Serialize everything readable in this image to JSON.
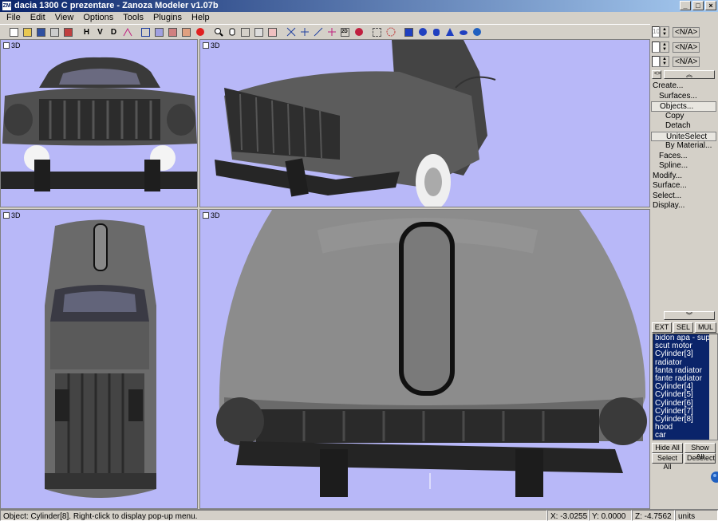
{
  "window": {
    "title": "dacia 1300 C prezentare - Zanoza Modeler v1.07b",
    "app_icon": "ZM"
  },
  "menu": [
    "File",
    "Edit",
    "View",
    "Options",
    "Tools",
    "Plugins",
    "Help"
  ],
  "toolbar": {
    "h_label": "H",
    "v_label": "V",
    "d_label": "D"
  },
  "viewports": {
    "top_left": {
      "label": "3D"
    },
    "top_right": {
      "label": "3D"
    },
    "bottom_left": {
      "label": "3D"
    },
    "bottom_right": {
      "label": "3D"
    },
    "background_color": "#b8b8f8"
  },
  "panel": {
    "spinners": [
      "<N/A>",
      "<N/A>",
      "<N/A>"
    ],
    "spinner_first_value": "10",
    "commands": [
      {
        "label": "Create...",
        "level": 1
      },
      {
        "label": "Surfaces...",
        "level": 2
      },
      {
        "label": "Objects...",
        "level": 2,
        "boxed": true
      },
      {
        "label": "Copy",
        "level": 3
      },
      {
        "label": "Detach",
        "level": 3
      },
      {
        "label": "UniteSelect",
        "level": 3,
        "boxed": true
      },
      {
        "label": "By Material...",
        "level": 3
      },
      {
        "label": "Faces...",
        "level": 2
      },
      {
        "label": "Spline...",
        "level": 2
      },
      {
        "label": "Modify...",
        "level": 1
      },
      {
        "label": "Surface...",
        "level": 1
      },
      {
        "label": "Select...",
        "level": 1
      },
      {
        "label": "Display...",
        "level": 1
      }
    ],
    "mode_buttons": [
      "EXT",
      "SEL",
      "MUL"
    ],
    "objects": [
      "bidon apa - supor",
      "scut motor",
      "Cylinder[3]",
      "radiator",
      "fanta radiator",
      "fante radiator",
      "Cylinder[4]",
      "Cylinder[5]",
      "Cylinder[6]",
      "Cylinder[7]",
      "Cylinder[8]",
      "hood",
      "car"
    ],
    "hide_all": "Hide All",
    "show_all": "Show All",
    "select_all": "Select All",
    "deselect": "Deselect"
  },
  "status": {
    "message": "Object: Cylinder[8]. Right-click to display pop-up menu.",
    "x": "X: -3.0255",
    "y": "Y: 0.0000",
    "z": "Z: -4.7562",
    "units": "units"
  }
}
